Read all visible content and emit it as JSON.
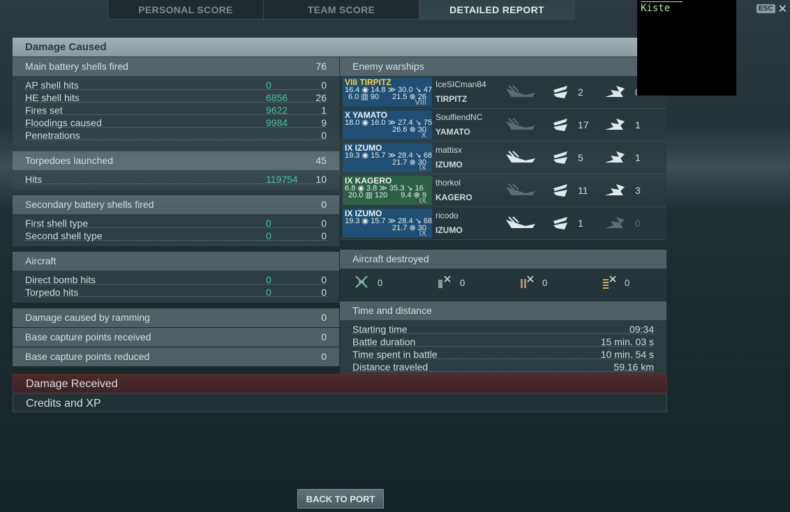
{
  "tabs": [
    "PERSONAL SCORE",
    "TEAM SCORE",
    "DETAILED REPORT"
  ],
  "active_tab": "DETAILED REPORT",
  "overlay": {
    "chat_text": "Kiste",
    "esc_label": "ESC",
    "close_glyph": "✕"
  },
  "section_title": "Damage Caused",
  "left": {
    "main_battery": {
      "label": "Main battery shells fired",
      "value": "76"
    },
    "main_battery_rows": [
      {
        "label": "AP shell hits",
        "damage": "0",
        "count": "0"
      },
      {
        "label": "HE shell hits",
        "damage": "6856",
        "count": "26"
      },
      {
        "label": "Fires set",
        "damage": "9622",
        "count": "1"
      },
      {
        "label": "Floodings caused",
        "damage": "9984",
        "count": "9"
      },
      {
        "label": "Penetrations",
        "damage": "",
        "count": "0"
      }
    ],
    "torpedoes": {
      "label": "Torpedoes launched",
      "value": "45"
    },
    "torpedo_rows": [
      {
        "label": "Hits",
        "damage": "119754",
        "count": "10"
      }
    ],
    "secondary": {
      "label": "Secondary battery shells fired",
      "value": "0"
    },
    "secondary_rows": [
      {
        "label": "First shell type",
        "damage": "0",
        "count": "0"
      },
      {
        "label": "Second shell type",
        "damage": "0",
        "count": "0"
      }
    ],
    "aircraft": {
      "label": "Aircraft"
    },
    "aircraft_rows": [
      {
        "label": "Direct bomb hits",
        "damage": "0",
        "count": "0"
      },
      {
        "label": "Torpedo hits",
        "damage": "0",
        "count": "0"
      }
    ],
    "ramming": {
      "label": "Damage caused by ramming",
      "value": "0"
    },
    "capture_received": {
      "label": "Base capture points received",
      "value": "0"
    },
    "capture_reduced": {
      "label": "Base capture points reduced",
      "value": "0"
    }
  },
  "right": {
    "enemy_title": "Enemy warships",
    "ships": [
      {
        "card": "VIII TIRPITZ",
        "gold": true,
        "green": false,
        "s1": "16.4 ◉ 14.8  ≫ 30.0 ↘ 47",
        "s2": "6.0 ▥ 90",
        "s3": "21.5 ⊗ 26",
        "tier": "VIII",
        "player": "IceSICman84",
        "ship": "TIRPITZ",
        "sunk": false,
        "hits": "2",
        "damage": "0",
        "dmg_dim": false
      },
      {
        "card": "X YAMATO",
        "gold": false,
        "green": false,
        "s1": "18.0 ◉ 16.0  ≫ 27.4 ↘ 75",
        "s2": "",
        "s3": "26.6 ⊗ 30",
        "tier": "X",
        "player": "SoulfiendNC",
        "ship": "YAMATO",
        "sunk": false,
        "hits": "17",
        "damage": "1",
        "dmg_dim": false
      },
      {
        "card": "IX IZUMO",
        "gold": false,
        "green": false,
        "s1": "19.3 ◉ 15.7  ≫ 28.4 ↘ 68",
        "s2": "",
        "s3": "21.7 ⊗ 30",
        "tier": "IX",
        "player": "mattisx",
        "ship": "IZUMO",
        "sunk": true,
        "hits": "5",
        "damage": "1",
        "dmg_dim": false
      },
      {
        "card": "IX KAGERO",
        "gold": false,
        "green": true,
        "s1": "6.8 ◉ 3.8  ≫ 35.3 ↘ 16",
        "s2": "20.0 ▥ 120",
        "s3": "9.4 ⊗ 9",
        "tier": "IX",
        "player": "thorkol",
        "ship": "KAGERO",
        "sunk": false,
        "hits": "11",
        "damage": "3",
        "dmg_dim": false
      },
      {
        "card": "IX IZUMO",
        "gold": false,
        "green": false,
        "s1": "19.3 ◉ 15.7  ≫ 28.4 ↘ 68",
        "s2": "",
        "s3": "21.7 ⊗ 30",
        "tier": "IX",
        "player": "ricodo",
        "ship": "IZUMO",
        "sunk": true,
        "hits": "1",
        "damage": "0",
        "dmg_dim": true
      }
    ],
    "aircraft_title": "Aircraft destroyed",
    "aircraft_counts": [
      "0",
      "0",
      "0",
      "0"
    ],
    "time_title": "Time and distance",
    "time_rows": [
      {
        "label": "Starting time",
        "value": "09:34"
      },
      {
        "label": "Battle duration",
        "value": "15 min. 03 s"
      },
      {
        "label": "Time spent in battle",
        "value": "10 min. 54 s"
      },
      {
        "label": "Distance traveled",
        "value": "59.16 km"
      }
    ]
  },
  "damage_received": "Damage Received",
  "credits_xp": "Credits and XP",
  "back_button": "BACK TO PORT"
}
